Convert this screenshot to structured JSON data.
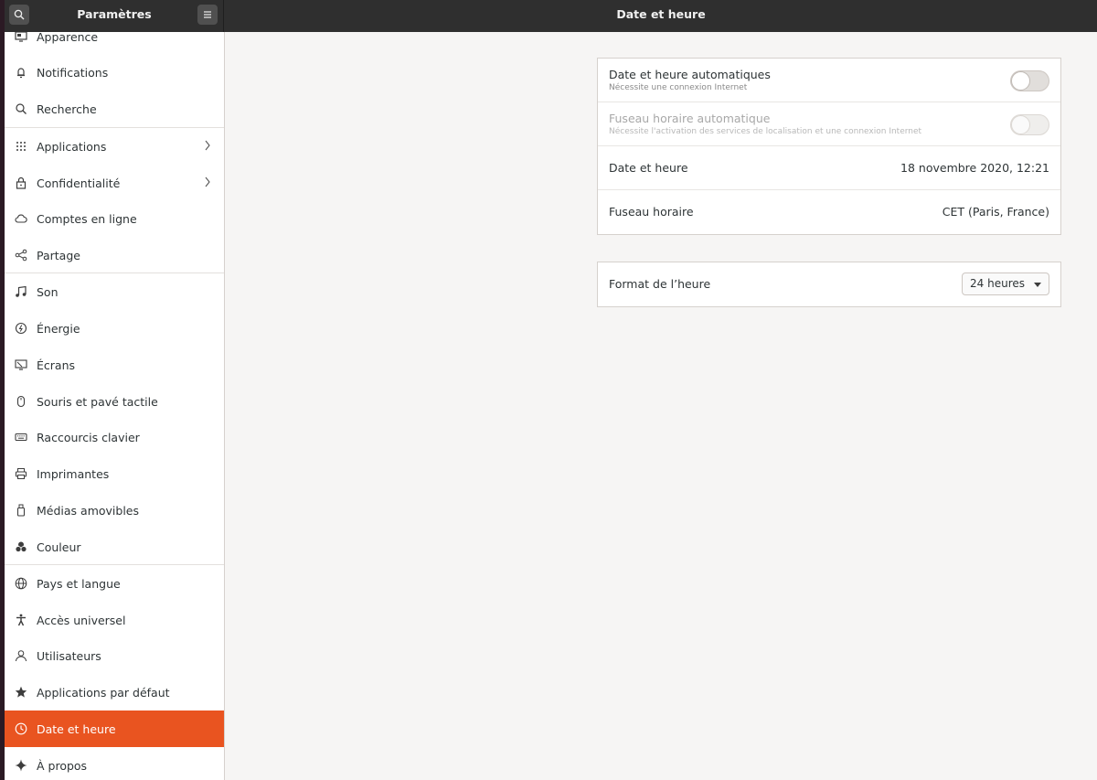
{
  "header": {
    "sidebar_title": "Paramètres",
    "page_title": "Date et heure"
  },
  "sidebar": {
    "items": [
      {
        "label": "Apparence",
        "icon": "appearance-icon"
      },
      {
        "label": "Notifications",
        "icon": "bell-icon"
      },
      {
        "label": "Recherche",
        "icon": "search-icon"
      },
      {
        "label": "Applications",
        "icon": "apps-grid-icon"
      },
      {
        "label": "Confidentialité",
        "icon": "lock-icon"
      },
      {
        "label": "Comptes en ligne",
        "icon": "cloud-icon"
      },
      {
        "label": "Partage",
        "icon": "share-icon"
      },
      {
        "label": "Son",
        "icon": "music-note-icon"
      },
      {
        "label": "Énergie",
        "icon": "power-icon"
      },
      {
        "label": "Écrans",
        "icon": "display-icon"
      },
      {
        "label": "Souris et pavé tactile",
        "icon": "mouse-icon"
      },
      {
        "label": "Raccourcis clavier",
        "icon": "keyboard-icon"
      },
      {
        "label": "Imprimantes",
        "icon": "printer-icon"
      },
      {
        "label": "Médias amovibles",
        "icon": "usb-drive-icon"
      },
      {
        "label": "Couleur",
        "icon": "color-icon"
      },
      {
        "label": "Pays et langue",
        "icon": "globe-icon"
      },
      {
        "label": "Accès universel",
        "icon": "accessibility-icon"
      },
      {
        "label": "Utilisateurs",
        "icon": "users-icon"
      },
      {
        "label": "Applications par défaut",
        "icon": "star-icon"
      },
      {
        "label": "Date et heure",
        "icon": "clock-icon"
      },
      {
        "label": "À propos",
        "icon": "sparkle-icon"
      }
    ],
    "active": "Date et heure"
  },
  "datetime": {
    "auto_datetime": {
      "title": "Date et heure automatiques",
      "subtitle": "Nécessite une connexion Internet",
      "enabled": false
    },
    "auto_timezone": {
      "title": "Fuseau horaire automatique",
      "subtitle": "Nécessite l'activation des services de localisation et une connexion Internet",
      "enabled": false
    },
    "date_time": {
      "title": "Date et heure",
      "value": "18 novembre 2020, 12:21"
    },
    "timezone": {
      "title": "Fuseau horaire",
      "value": "CET (Paris, France)"
    }
  },
  "time_format": {
    "title": "Format de l’heure",
    "value": "24 heures"
  },
  "colors": {
    "accent": "#e95420",
    "headerbar": "#2f2f2f"
  }
}
